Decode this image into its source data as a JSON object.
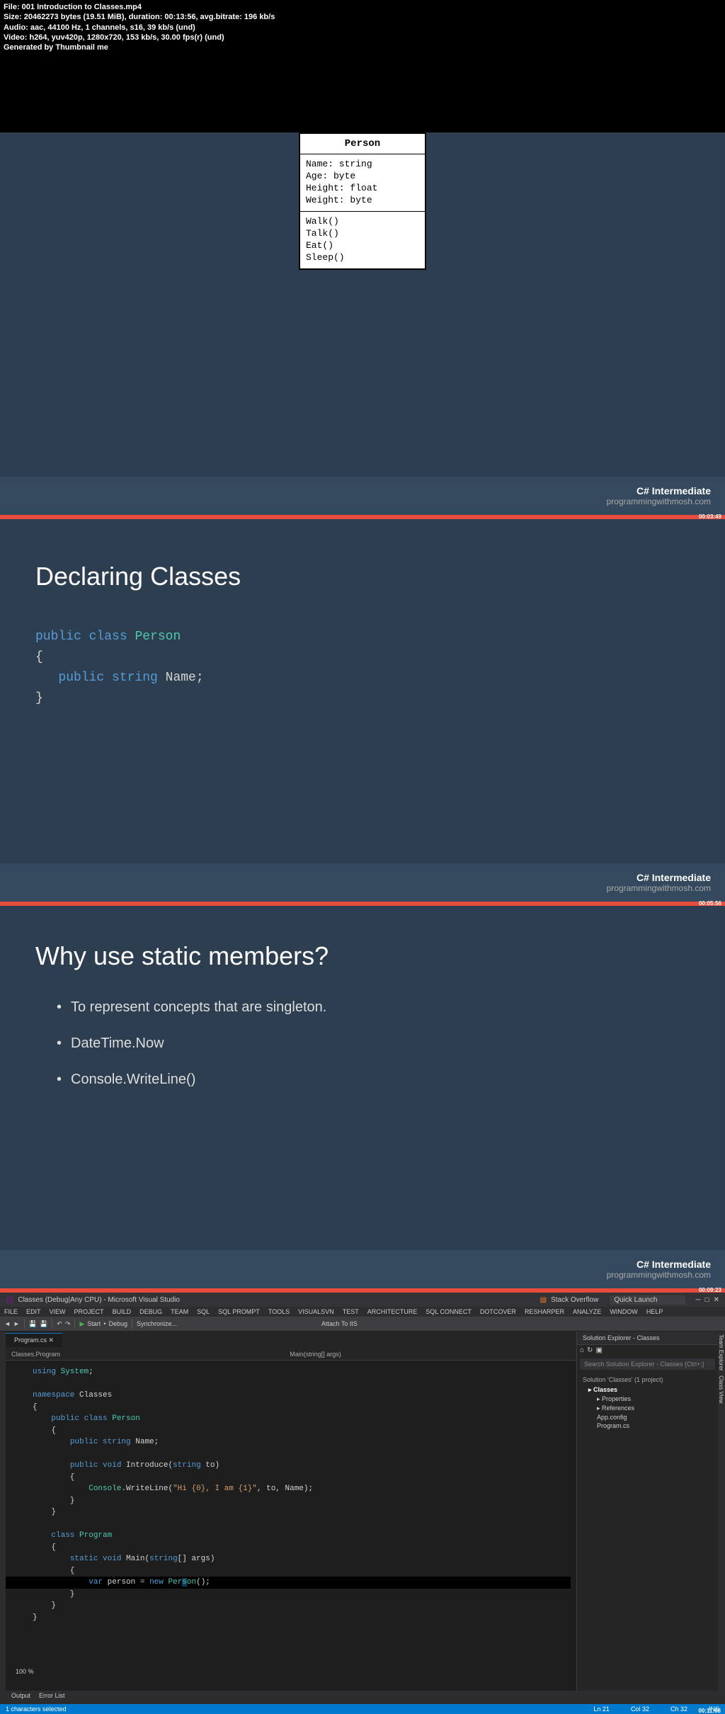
{
  "meta": {
    "file": "File: 001 Introduction to Classes.mp4",
    "size": "Size: 20462273 bytes (19.51 MiB), duration: 00:13:56, avg.bitrate: 196 kb/s",
    "audio": "Audio: aac, 44100 Hz, 1 channels, s16, 39 kb/s (und)",
    "video": "Video: h264, yuv420p, 1280x720, 153 kb/s, 30.00 fps(r) (und)",
    "gen": "Generated by Thumbnail me"
  },
  "timestamps": {
    "t1": "00:03:49",
    "t2": "00:05:56",
    "t3": "00:09:23",
    "t4": "00:11:08"
  },
  "footer": {
    "title": "C# Intermediate",
    "url": "programmingwithmosh.com"
  },
  "uml": {
    "title": "Person",
    "attrs": [
      "Name: string",
      "Age: byte",
      "Height: float",
      "Weight: byte"
    ],
    "methods": [
      "Walk()",
      "Talk()",
      "Eat()",
      "Sleep()"
    ]
  },
  "slide2": {
    "title": "Declaring Classes",
    "code_tokens": [
      "public",
      "class",
      "Person",
      "{",
      "public",
      "string",
      "Name;",
      "}"
    ]
  },
  "slide3": {
    "title": "Why use static members?",
    "bullets": [
      "To represent concepts that are singleton.",
      "DateTime.Now",
      "Console.WriteLine()"
    ]
  },
  "vs": {
    "title": "Classes (Debug|Any CPU) - Microsoft Visual Studio",
    "menu": [
      "FILE",
      "EDIT",
      "VIEW",
      "PROJECT",
      "BUILD",
      "DEBUG",
      "TEAM",
      "SQL",
      "SQL PROMPT",
      "TOOLS",
      "VISUALSVN",
      "TEST",
      "ARCHITECTURE",
      "SQL CONNECT",
      "DOTCOVER",
      "RESHARPER",
      "ANALYZE",
      "WINDOW",
      "HELP"
    ],
    "toolbar": {
      "start": "Start",
      "debug": "Debug",
      "sync": "Synchronize...",
      "stack": "Stack Overflow",
      "quick": "Quick Launch",
      "attach": "Attach To IIS"
    },
    "tab": "Program.cs",
    "nav_left": "Classes.Program",
    "nav_right": "Main(string[] args)",
    "explorer": {
      "title": "Solution Explorer - Classes",
      "search": "Search Solution Explorer - Classes (Ctrl+;)",
      "root": "Solution 'Classes' (1 project)",
      "items": [
        "Classes",
        "Properties",
        "References",
        "App.config",
        "Program.cs"
      ]
    },
    "status": {
      "left": "1 characters selected",
      "ln": "Ln 21",
      "col": "Col 32",
      "ch": "Ch 32",
      "ins": "INS"
    },
    "bottom": [
      "Output",
      "Error List"
    ],
    "zoom": "100 %"
  }
}
